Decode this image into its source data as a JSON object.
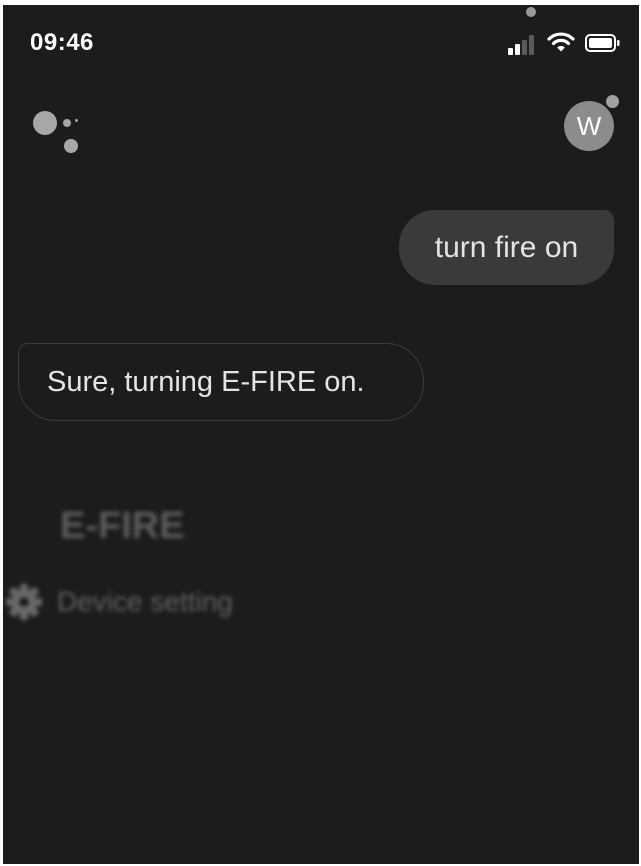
{
  "status_bar": {
    "time": "09:46",
    "signal_icon": "cellular-signal-icon",
    "wifi_icon": "wifi-icon",
    "battery_icon": "battery-icon"
  },
  "header": {
    "assistant_logo": "google-assistant-logo",
    "avatar_initial": "W"
  },
  "conversation": {
    "user_message": "turn fire on",
    "assistant_reply": "Sure, turning E-FIRE on."
  },
  "device_card": {
    "title": "E-FIRE",
    "setting_icon": "gear-icon",
    "setting_label": "Device setting"
  },
  "colors": {
    "background": "#1c1c1d",
    "user_bubble": "#3a3a3b",
    "avatar": "#8c8c8c",
    "text": "#e4e4e4"
  }
}
